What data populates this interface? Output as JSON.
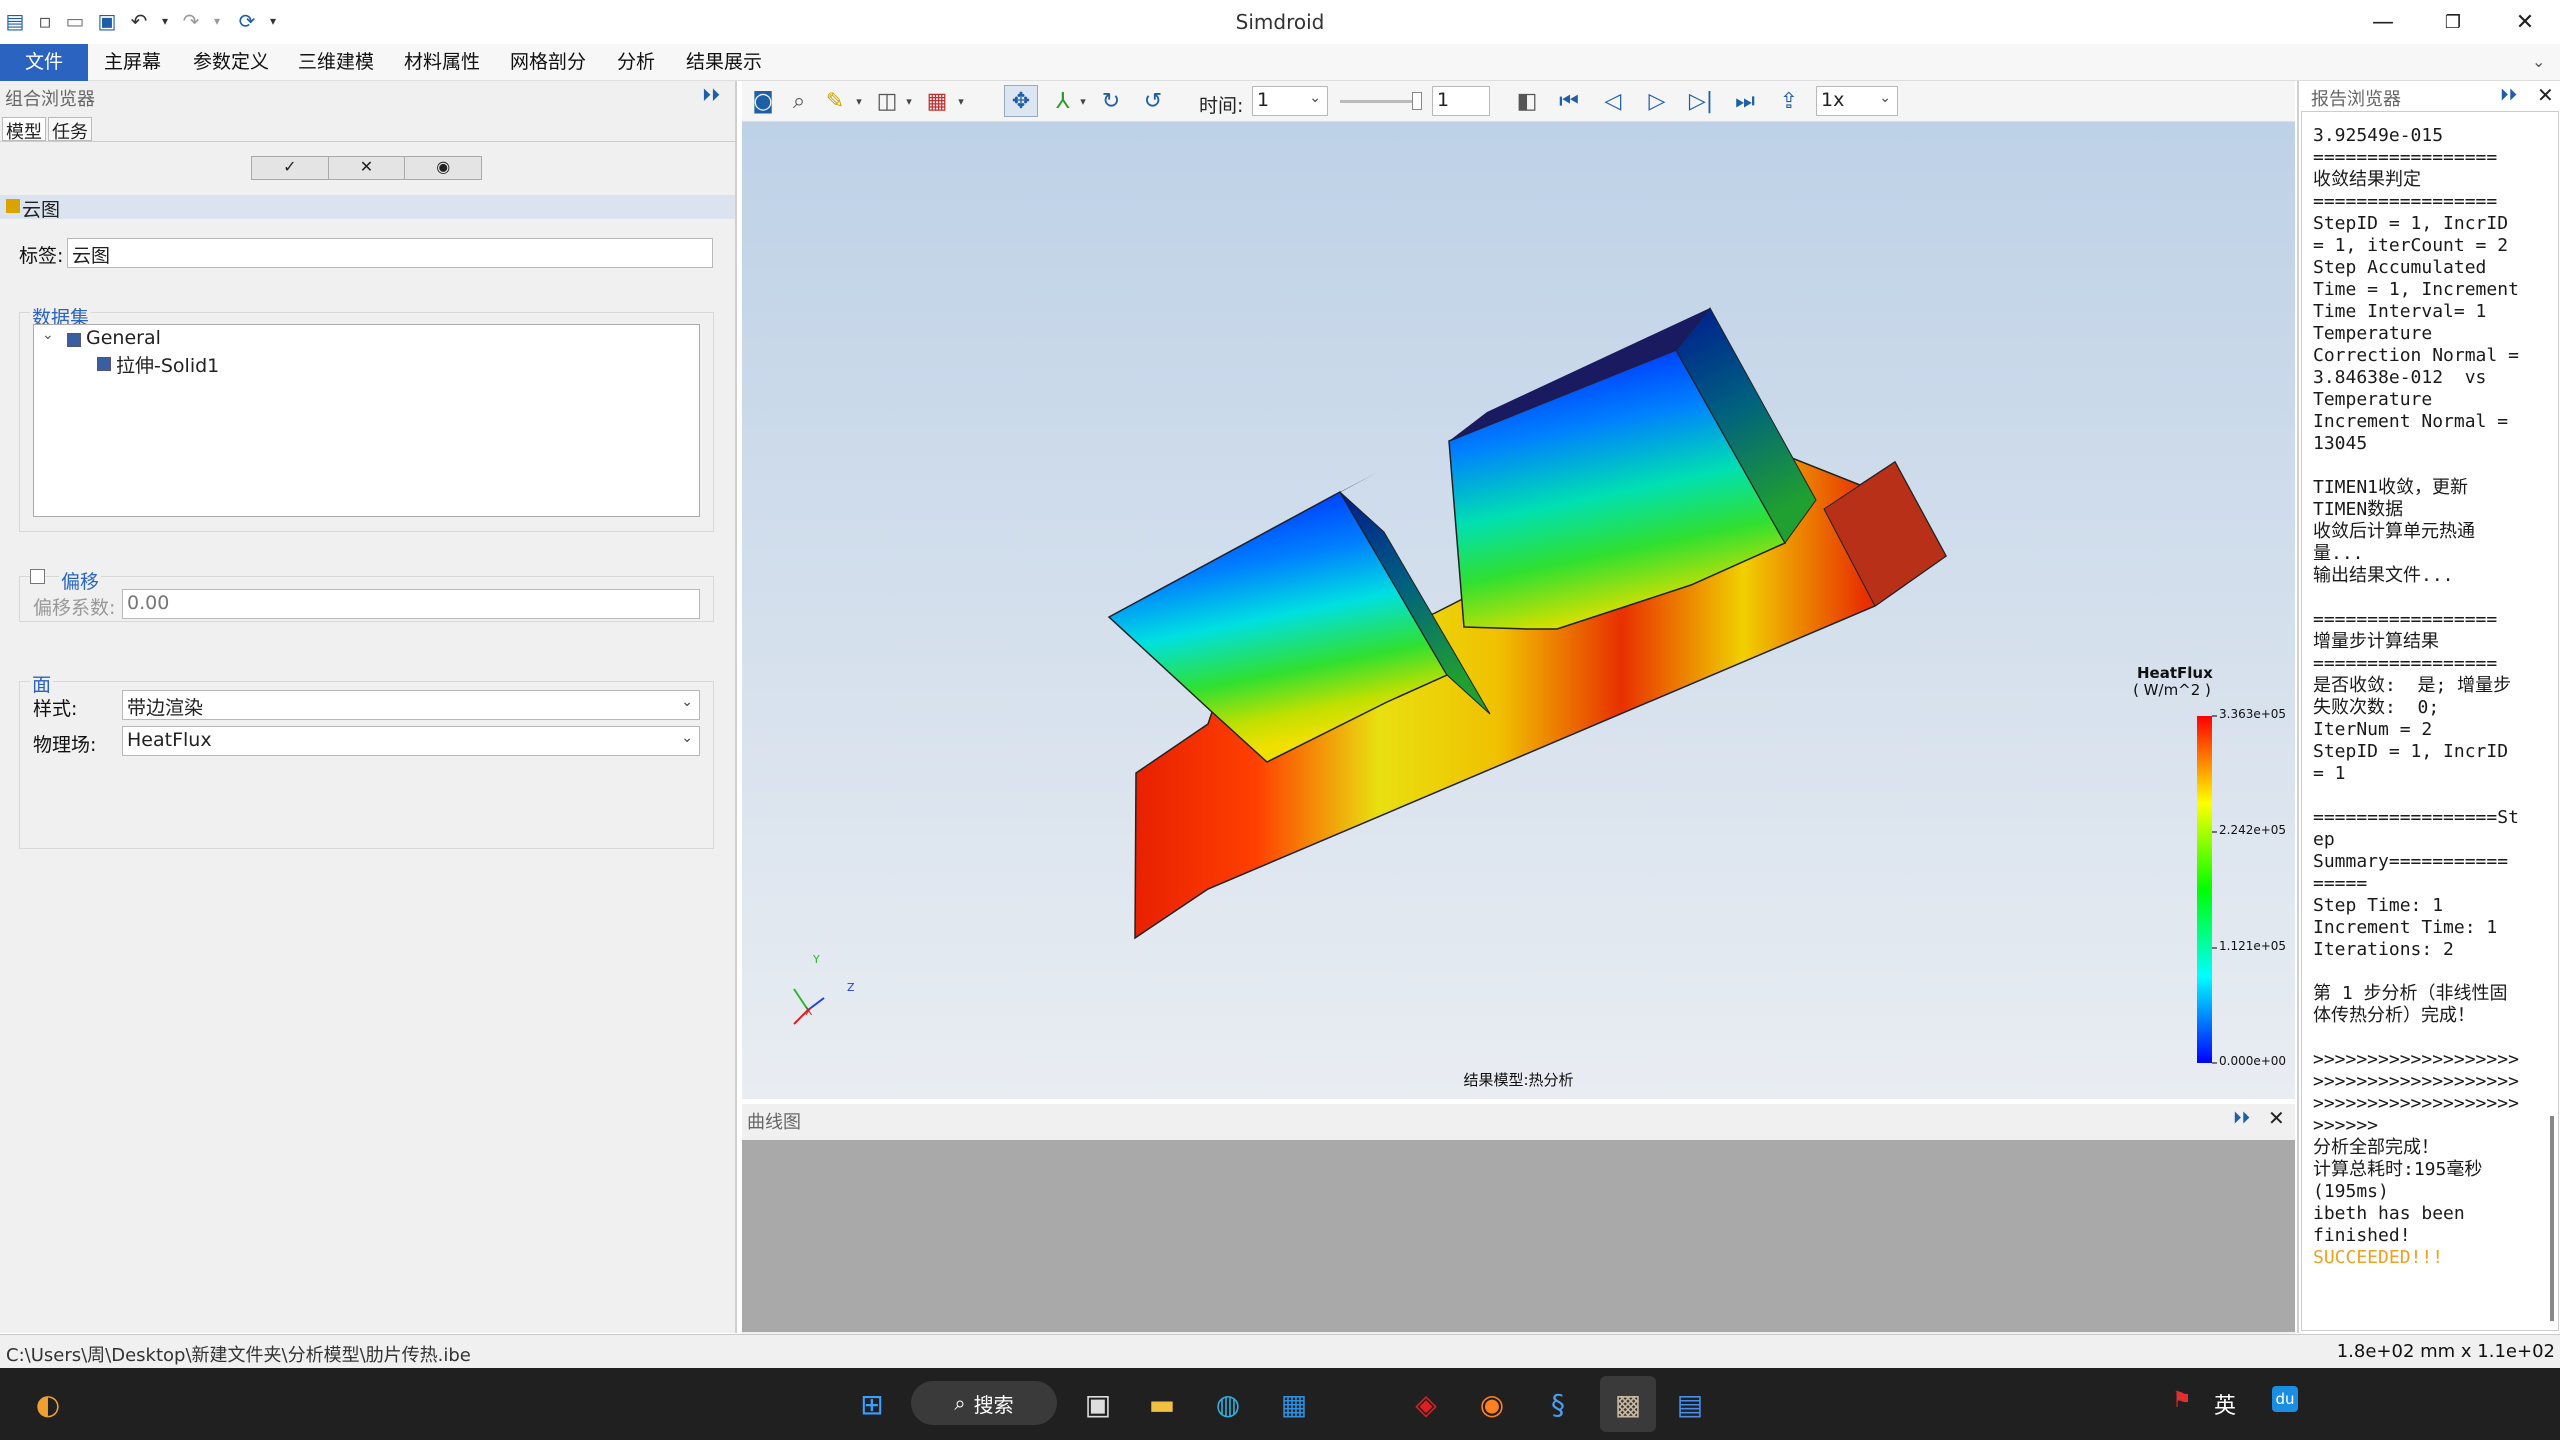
{
  "app": {
    "title": "Simdroid"
  },
  "menu": [
    "文件",
    "主屏幕",
    "参数定义",
    "三维建模",
    "材料属性",
    "网格剖分",
    "分析",
    "结果展示"
  ],
  "left": {
    "panel_title": "组合浏览器",
    "tabs": [
      "模型",
      "任务"
    ],
    "section": "云图",
    "label_caption": "标签:",
    "label_value": "云图",
    "dataset_title": "数据集",
    "tree": [
      "General",
      "拉伸-Solid1"
    ],
    "offset_title": "偏移",
    "offset_caption": "偏移系数:",
    "offset_value": "0.00",
    "face_title": "面",
    "style_caption": "样式:",
    "style_value": "带边渲染",
    "field_caption": "物理场:",
    "field_value": "HeatFlux"
  },
  "toolbar": {
    "time_label": "时间:",
    "time_value": "1",
    "frame_value": "1",
    "speed_value": "1x"
  },
  "viewport": {
    "legend_title": "HeatFlux",
    "legend_unit": "( W/m^2 )",
    "legend_ticks": [
      "3.363e+05",
      "2.242e+05",
      "1.121e+05",
      "0.000e+00"
    ],
    "caption": "结果模型:热分析",
    "axes": [
      "Y",
      "Z",
      "X"
    ]
  },
  "curve": {
    "title": "曲线图"
  },
  "report": {
    "title": "报告浏览器",
    "log": "3.92549e-015\n=================\n收敛结果判定\n=================\nStepID = 1, IncrID\n= 1, iterCount = 2\nStep Accumulated\nTime = 1, Increment\nTime Interval= 1\nTemperature\nCorrection Normal =\n3.84638e-012  vs\nTemperature\nIncrement Normal =\n13045\n\nTIMEN1收敛，更新\nTIMEN数据\n收敛后计算单元热通\n量...\n输出结果文件...\n\n=================\n增量步计算结果\n=================\n是否收敛:  是; 增量步\n失败次数:  0;\nIterNum = 2\nStepID = 1, IncrID\n= 1\n\n=================St\nep\nSummary===========\n=====\nStep Time: 1\nIncrement Time: 1\nIterations: 2\n\n第 1 步分析（非线性固\n体传热分析）完成！\n\n>>>>>>>>>>>>>>>>>>>\n>>>>>>>>>>>>>>>>>>>\n>>>>>>>>>>>>>>>>>>>\n>>>>>>\n分析全部完成！\n计算总耗时:195毫秒\n(195ms)\nibeth has been\nfinished!",
    "success": "SUCCEEDED!!!"
  },
  "status": {
    "path": "C:\\Users\\周\\Desktop\\新建文件夹\\分析模型\\肋片传热.ibe",
    "dims": "1.8e+02 mm x 1.1e+02 mm"
  },
  "taskbar": {
    "search": "搜索",
    "ime": "英"
  }
}
